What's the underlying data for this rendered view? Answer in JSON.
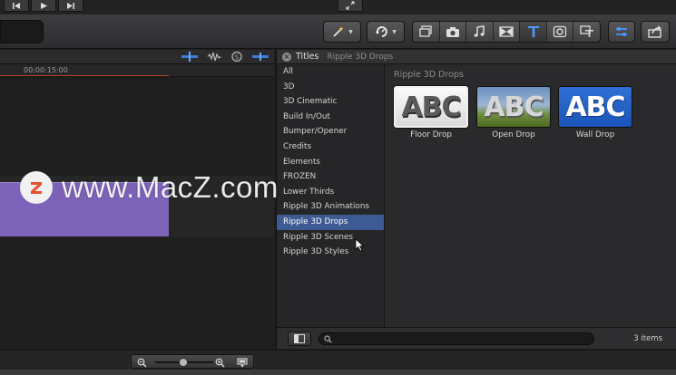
{
  "colors": {
    "selection": "#3e5a92",
    "clip": "#7c63b8",
    "accent_blue": "#4a9bff",
    "playhead": "#b24a2a"
  },
  "viewer": {
    "icons": [
      "skip-back-icon",
      "play-icon",
      "skip-forward-icon",
      "fullscreen-icon"
    ]
  },
  "toolbar": {
    "icons": [
      "magic-wand-icon",
      "retime-icon",
      "photo-browser-icon",
      "camera-icon",
      "music-icon",
      "transitions-icon",
      "titles-icon",
      "generators-icon",
      "themes-icon",
      "inspector-icon",
      "share-icon"
    ],
    "active": "titles-icon"
  },
  "timeline": {
    "timecode": "00:00:15:00"
  },
  "browser": {
    "title": "Titles",
    "breadcrumb": "Ripple 3D Drops",
    "categories": [
      "All",
      "3D",
      "3D Cinematic",
      "Build In/Out",
      "Bumper/Opener",
      "Credits",
      "Elements",
      "FROZEN",
      "Lower Thirds",
      "Ripple 3D Animations",
      "Ripple 3D Drops",
      "Ripple 3D Scenes",
      "Ripple 3D Styles"
    ],
    "selected_category": "Ripple 3D Drops",
    "section_heading": "Ripple 3D Drops",
    "items": [
      {
        "label": "Floor Drop",
        "thumb_text": "ABC"
      },
      {
        "label": "Open Drop",
        "thumb_text": "ABC"
      },
      {
        "label": "Wall Drop",
        "thumb_text": "ABC"
      }
    ],
    "search_placeholder": "",
    "item_count": "3 items"
  },
  "watermark": {
    "logo_letter": "Z",
    "text": "www.MacZ.com"
  }
}
